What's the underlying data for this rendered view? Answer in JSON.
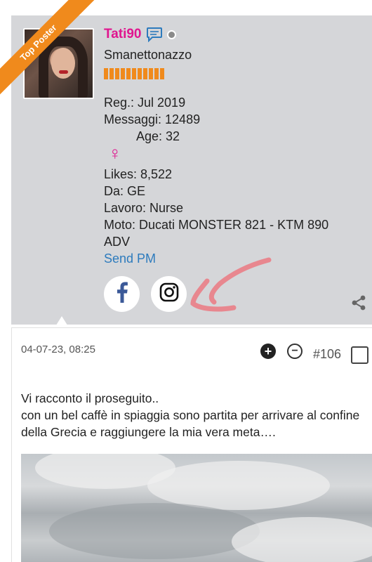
{
  "profile": {
    "username": "Tati90",
    "user_title": "Smanettonazzo",
    "ribbon_label": "Top Poster",
    "rank_color": "#f08a1c",
    "username_color": "#e0168f",
    "status": "offline",
    "registered": "Reg.: Jul 2019",
    "messages": "Messaggi: 12489",
    "age": "Age: 32",
    "gender_icon": "♀",
    "likes": "Likes: 8,522",
    "location": "Da: GE",
    "job": "Lavoro: Nurse",
    "bike": "Moto: Ducati MONSTER 821 - KTM 890 ADV",
    "send_pm": "Send PM"
  },
  "social": {
    "facebook_icon": "facebook-icon",
    "instagram_icon": "instagram-icon",
    "share_icon": "share-icon"
  },
  "post": {
    "date": "04-07-23, 08:25",
    "number": "#106",
    "vote_up": "+",
    "vote_down": "−",
    "text_line1": "Vi racconto il proseguito..",
    "text_line2": "con un bel caffè in spiaggia sono partita per arrivare al confine della Grecia e raggiungere la mia vera meta…."
  }
}
